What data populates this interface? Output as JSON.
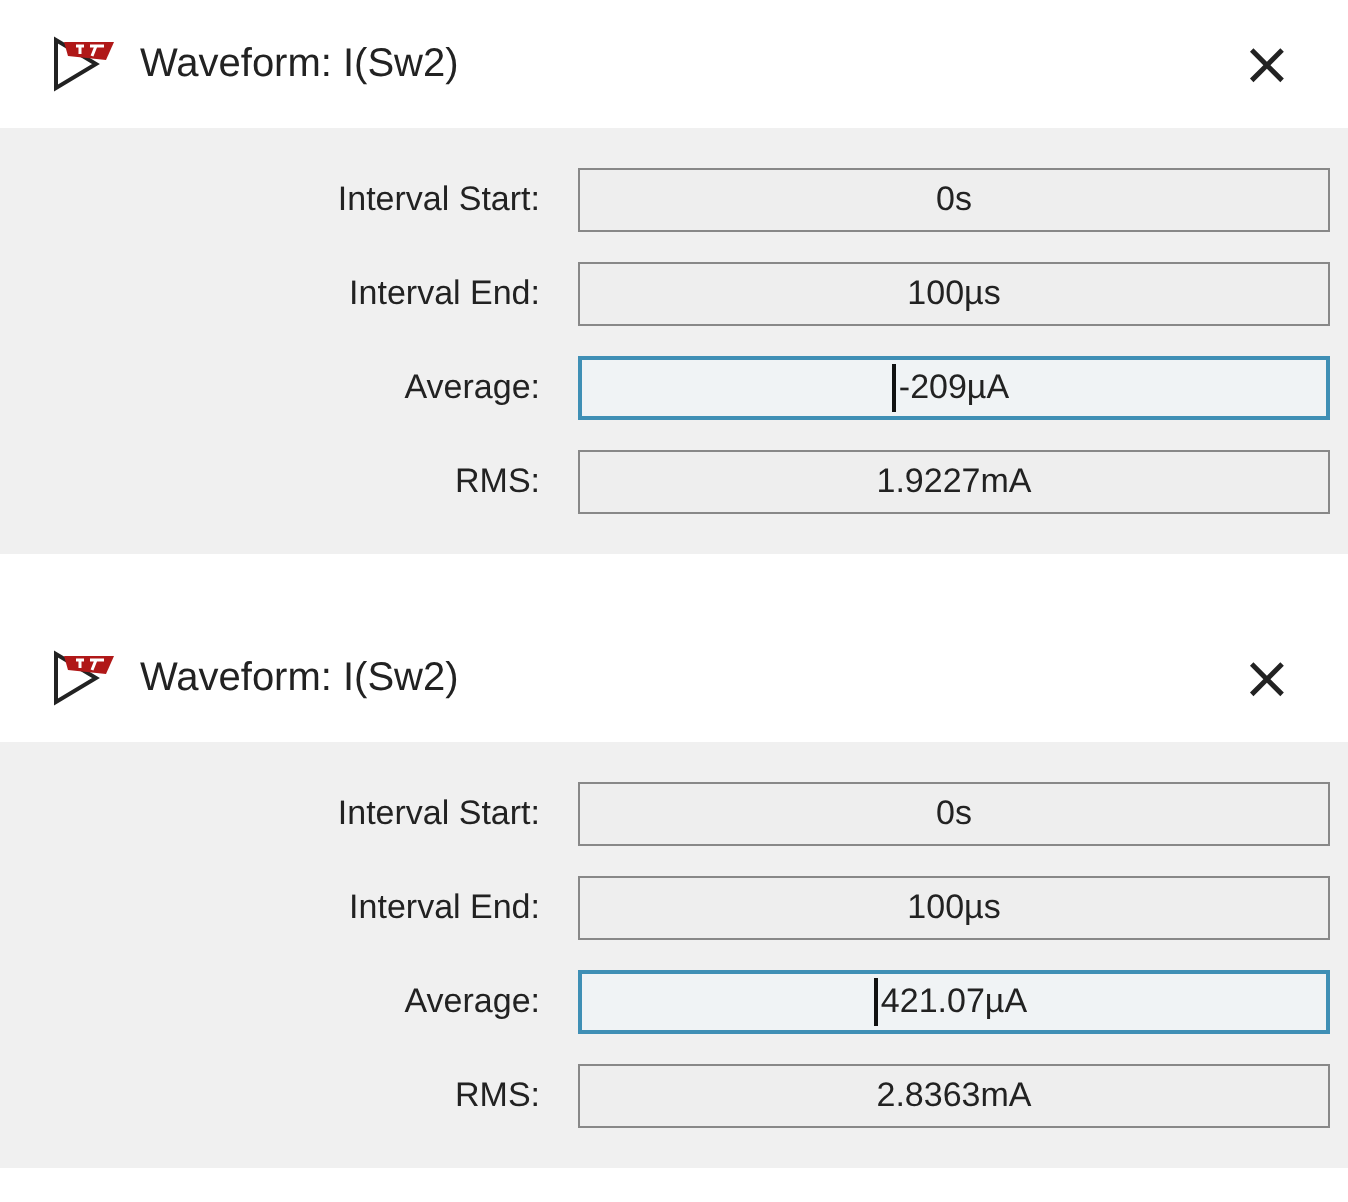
{
  "windows": [
    {
      "title": "Waveform: I(Sw2)",
      "close": "×",
      "fields": [
        {
          "label": "Interval Start:",
          "value": "0s",
          "focused": false
        },
        {
          "label": "Interval End:",
          "value": "100µs",
          "focused": false
        },
        {
          "label": "Average:",
          "value": "-209µA",
          "focused": true
        },
        {
          "label": "RMS:",
          "value": "1.9227mA",
          "focused": false
        }
      ]
    },
    {
      "title": "Waveform: I(Sw2)",
      "close": "×",
      "fields": [
        {
          "label": "Interval Start:",
          "value": "0s",
          "focused": false
        },
        {
          "label": "Interval End:",
          "value": "100µs",
          "focused": false
        },
        {
          "label": "Average:",
          "value": "421.07µA",
          "focused": true
        },
        {
          "label": "RMS:",
          "value": "2.8363mA",
          "focused": false
        }
      ]
    }
  ]
}
